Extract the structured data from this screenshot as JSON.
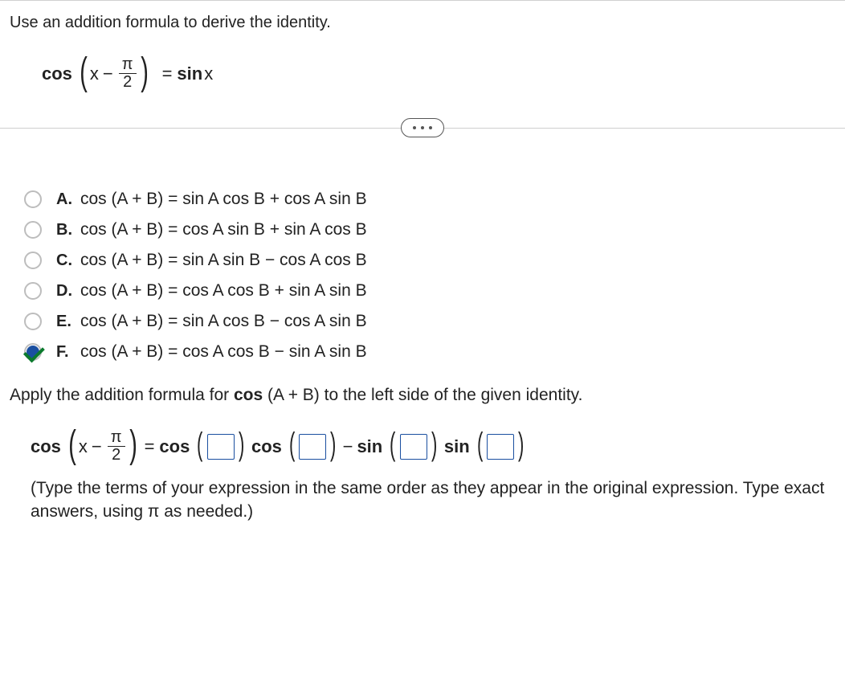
{
  "prompt": "Use an addition formula to derive the identity.",
  "identity": {
    "lhs_func": "cos",
    "lhs_var": "x",
    "lhs_op": "−",
    "frac_num": "π",
    "frac_den": "2",
    "eq": "=",
    "rhs_func": "sin",
    "rhs_var": "x"
  },
  "options": [
    {
      "letter": "A.",
      "formula": "cos (A + B) = sin A cos B +  cos A sin B",
      "selected": false
    },
    {
      "letter": "B.",
      "formula": "cos (A + B) = cos A sin B +  sin A cos B",
      "selected": false
    },
    {
      "letter": "C.",
      "formula": "cos (A + B) = sin A sin B −  cos A cos B",
      "selected": false
    },
    {
      "letter": "D.",
      "formula": "cos (A + B) = cos A cos B +  sin A sin B",
      "selected": false
    },
    {
      "letter": "E.",
      "formula": "cos (A + B) = sin A cos B −  cos A sin B",
      "selected": false
    },
    {
      "letter": "F.",
      "formula": "cos (A + B) = cos A cos B −  sin A sin B",
      "selected": true
    }
  ],
  "apply_text_1": "Apply the addition formula for ",
  "apply_text_bold": "cos",
  "apply_text_2": " (A + B) to the left side of the given identity.",
  "sub_eq": {
    "lhs_func": "cos",
    "lhs_var": "x",
    "lhs_op": "−",
    "frac_num": "π",
    "frac_den": "2",
    "eq": "=",
    "t1": "cos",
    "t2": "cos",
    "minus": "−",
    "t3": "sin",
    "t4": "sin"
  },
  "hint": "(Type the terms of your expression in the same order as they appear in the original expression. Type exact answers, using π as needed.)"
}
